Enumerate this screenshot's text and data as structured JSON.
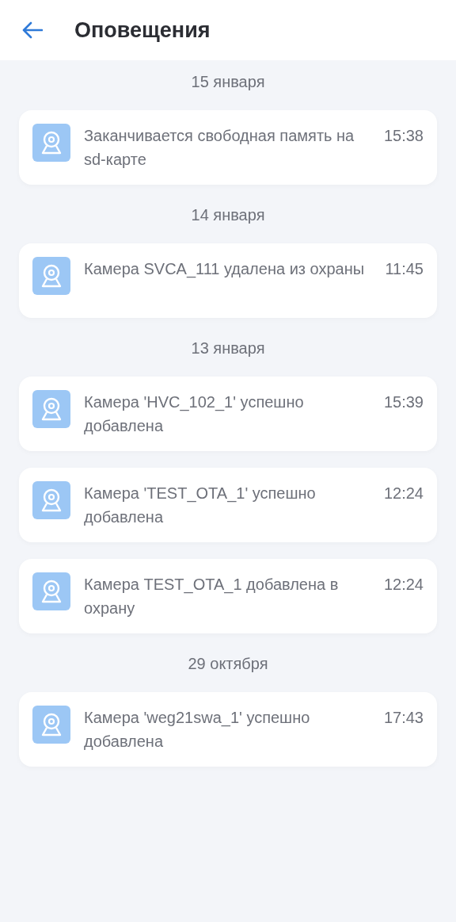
{
  "header": {
    "title": "Оповещения"
  },
  "groups": [
    {
      "date": "15 января",
      "items": [
        {
          "text": "Заканчивается свободная память на sd-карте",
          "time": "15:38"
        }
      ]
    },
    {
      "date": "14 января",
      "items": [
        {
          "text": "Камера SVCA_111 удалена из охраны",
          "time": "11:45"
        }
      ]
    },
    {
      "date": "13 января",
      "items": [
        {
          "text": "Камера 'HVC_102_1' успешно добавлена",
          "time": "15:39"
        },
        {
          "text": "Камера 'TEST_OTA_1' успешно добавлена",
          "time": "12:24"
        },
        {
          "text": "Камера TEST_OTA_1 добавлена в охрану",
          "time": "12:24"
        }
      ]
    },
    {
      "date": "29 октября",
      "items": [
        {
          "text": "Камера 'weg21swa_1' успешно добавлена",
          "time": "17:43"
        }
      ]
    }
  ]
}
